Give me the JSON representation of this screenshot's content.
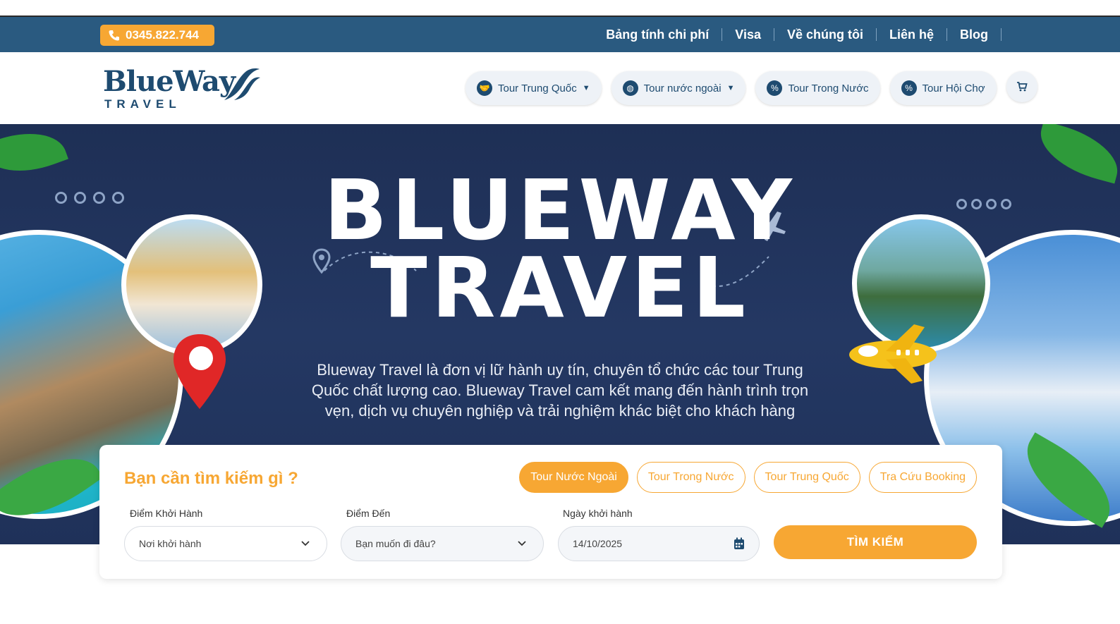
{
  "colors": {
    "topbar": "#2a5a80",
    "accent": "#f7a733",
    "brand": "#1e4b70",
    "hero": "#1f3159"
  },
  "topbar": {
    "phone": "0345.822.744",
    "phone_icon": "phone-icon",
    "links": [
      "Bảng tính chi phí",
      "Visa",
      "Về chúng tôi",
      "Liên hệ",
      "Blog"
    ]
  },
  "header": {
    "logo_word": "BlueWay",
    "logo_sub": "TRAVEL",
    "nav": [
      {
        "label": "Tour Trung Quốc",
        "icon": "handshake-icon",
        "dropdown": true
      },
      {
        "label": "Tour nước ngoài",
        "icon": "globe-icon",
        "dropdown": true
      },
      {
        "label": "Tour Trong Nước",
        "icon": "percent-badge-icon",
        "dropdown": false
      },
      {
        "label": "Tour Hội Chợ",
        "icon": "percent-badge-icon",
        "dropdown": false
      }
    ],
    "cart_icon": "cart-icon"
  },
  "hero": {
    "title_line1": "BLUEWAY",
    "title_line2": "TRAVEL",
    "description": "Blueway Travel là đơn vị lữ hành uy tín, chuyên tổ chức các tour Trung Quốc chất lượng cao. Blueway Travel cam kết mang đến hành trình trọn vẹn, dịch vụ chuyên nghiệp và trải nghiệm khác biệt cho khách hàng"
  },
  "search": {
    "title": "Bạn cần tìm kiếm gì ?",
    "tabs": [
      "Tour Nước Ngoài",
      "Tour Trong Nước",
      "Tour Trung Quốc",
      "Tra Cứu Booking"
    ],
    "active_tab": "Tour Nước Ngoài",
    "departure": {
      "label": "Điểm Khởi Hành",
      "placeholder": "Nơi khởi hành"
    },
    "destination": {
      "label": "Điểm Đến",
      "placeholder": "Bạn muốn đi đâu?"
    },
    "date": {
      "label": "Ngày khởi hành",
      "value": "14/10/2025"
    },
    "button": "TÌM KIẾM"
  }
}
